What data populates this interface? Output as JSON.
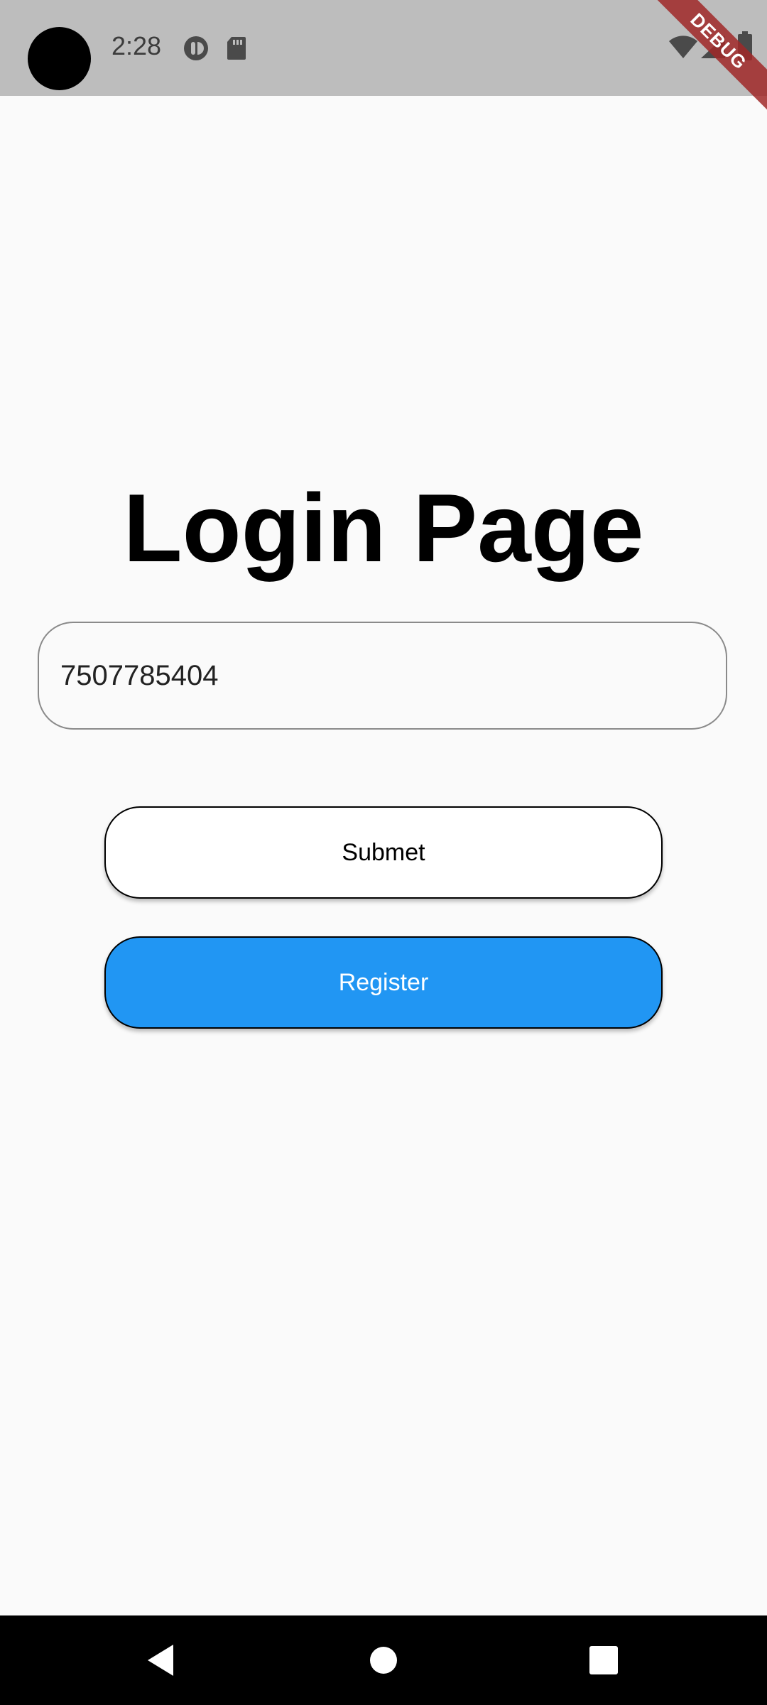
{
  "status_bar": {
    "time": "2:28",
    "icons": [
      "app-notification-icon",
      "sd-card-icon",
      "wifi-icon",
      "signal-icon",
      "battery-icon"
    ]
  },
  "debug_banner": {
    "label": "DEBUG",
    "color": "#a02828"
  },
  "main": {
    "title": "Login Page",
    "phone_input": {
      "value": "7507785404"
    },
    "submit_button": {
      "label": "Submet",
      "background": "#ffffff"
    },
    "register_button": {
      "label": "Register",
      "background": "#2196f3"
    }
  },
  "nav_bar": {
    "buttons": [
      "back-icon",
      "home-icon",
      "recents-icon"
    ]
  }
}
